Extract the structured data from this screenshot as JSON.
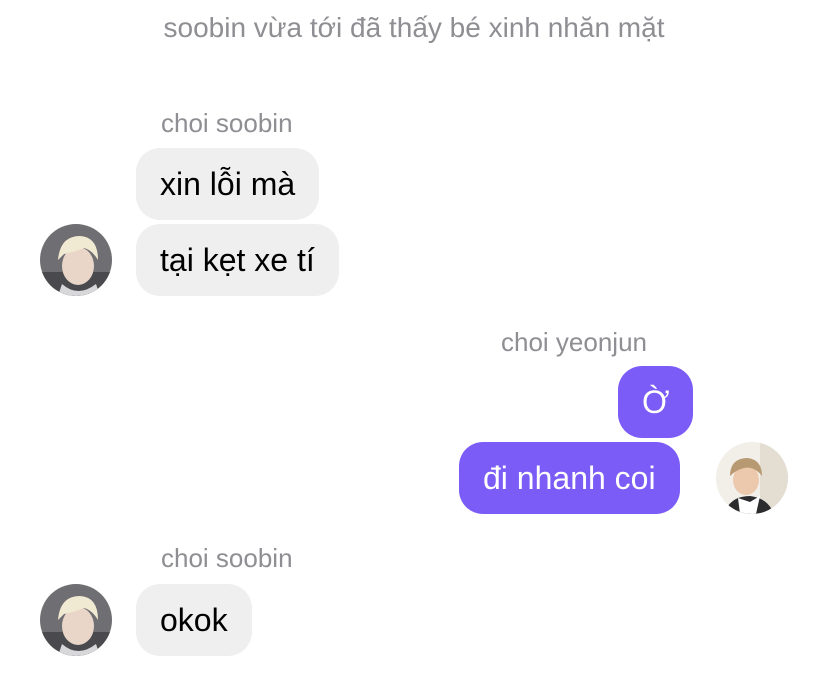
{
  "chat": {
    "system_note": "soobin vừa tới đã thấy bé xinh nhăn mặt",
    "groups": [
      {
        "sender": "choi soobin",
        "side": "left",
        "messages": [
          "xin lỗi mà",
          "tại kẹt xe tí"
        ]
      },
      {
        "sender": "choi yeonjun",
        "side": "right",
        "messages": [
          "Ờ",
          "đi nhanh coi"
        ]
      },
      {
        "sender": "choi soobin",
        "side": "left",
        "messages": [
          "okok"
        ]
      }
    ]
  },
  "colors": {
    "incoming_bubble": "#efefef",
    "outgoing_bubble": "#7b5cf6",
    "sender_label": "#8e8e93",
    "background": "#ffffff"
  },
  "icons": {
    "soobin_avatar": "avatar-soobin-photo",
    "yeonjun_avatar": "avatar-yeonjun-photo"
  }
}
